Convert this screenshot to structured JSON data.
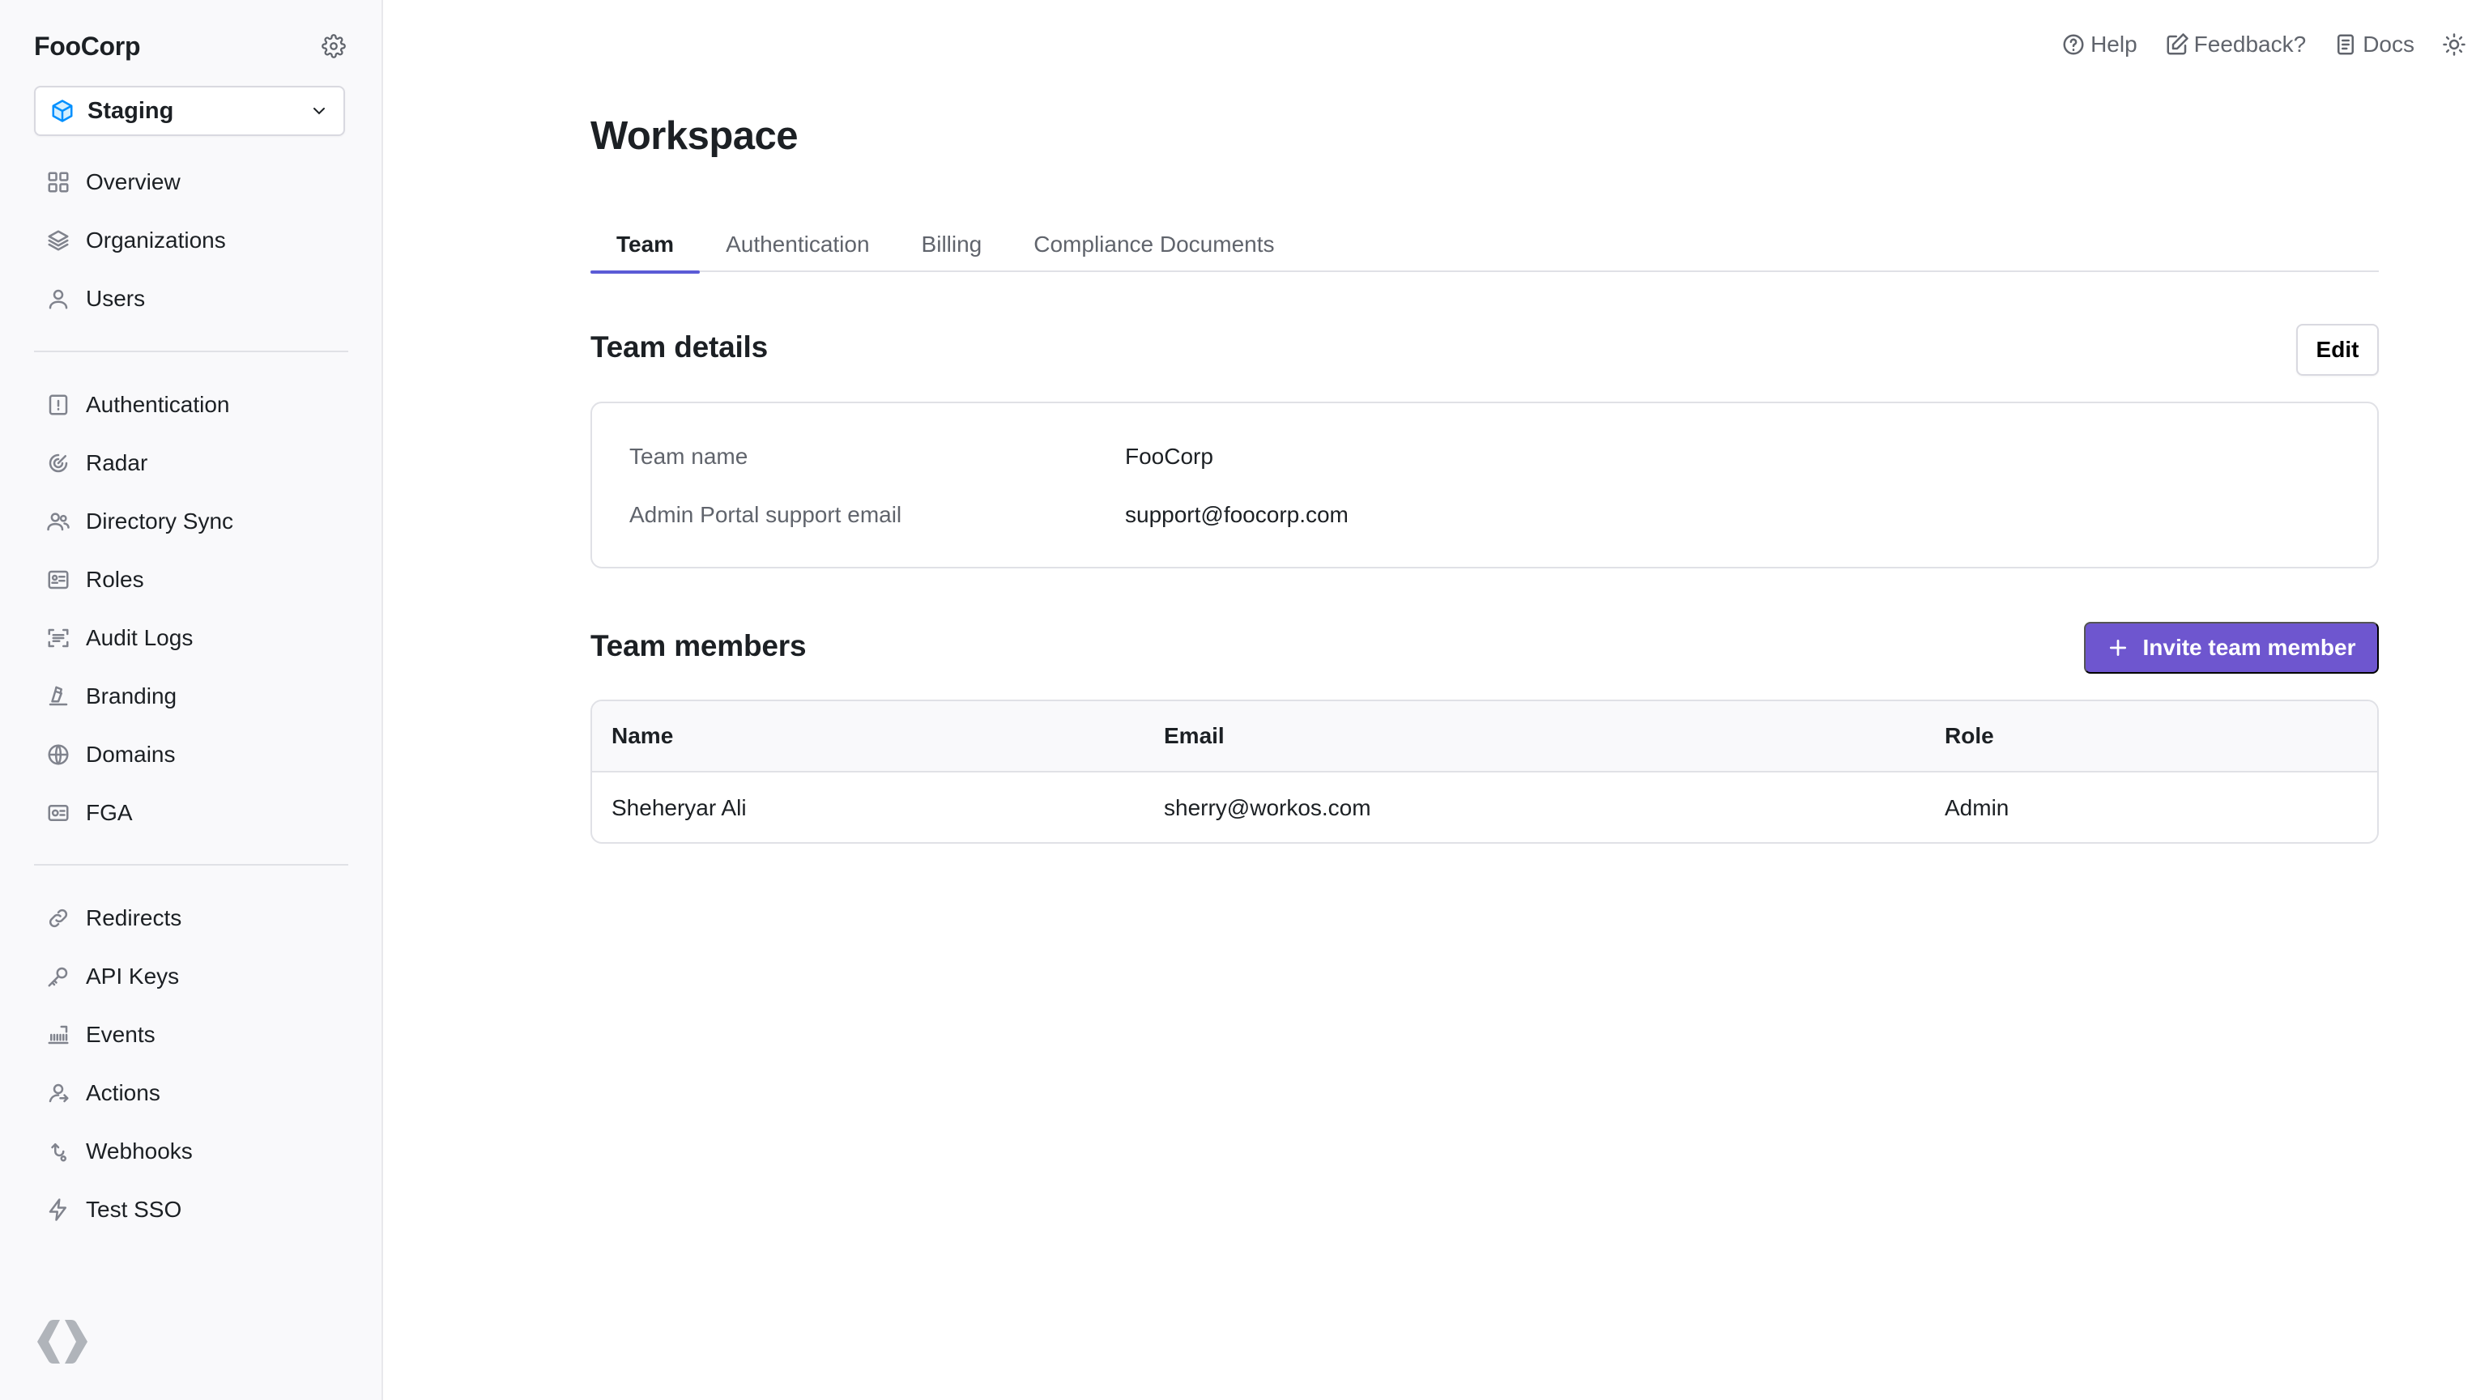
{
  "sidebar": {
    "brand": "FooCorp",
    "environment": "Staging",
    "primary_items": [
      {
        "label": "Overview",
        "icon": "grid-icon"
      },
      {
        "label": "Organizations",
        "icon": "layers-icon"
      },
      {
        "label": "Users",
        "icon": "user-icon"
      }
    ],
    "product_items": [
      {
        "label": "Authentication",
        "icon": "key-square-icon"
      },
      {
        "label": "Radar",
        "icon": "radar-icon"
      },
      {
        "label": "Directory Sync",
        "icon": "users-sync-icon"
      },
      {
        "label": "Roles",
        "icon": "id-card-icon"
      },
      {
        "label": "Audit Logs",
        "icon": "scan-icon"
      },
      {
        "label": "Branding",
        "icon": "brush-icon"
      },
      {
        "label": "Domains",
        "icon": "globe-icon"
      },
      {
        "label": "FGA",
        "icon": "ticket-icon"
      }
    ],
    "dev_items": [
      {
        "label": "Redirects",
        "icon": "link-icon"
      },
      {
        "label": "API Keys",
        "icon": "key-icon"
      },
      {
        "label": "Events",
        "icon": "events-icon"
      },
      {
        "label": "Actions",
        "icon": "actions-icon"
      },
      {
        "label": "Webhooks",
        "icon": "webhook-icon"
      },
      {
        "label": "Test SSO",
        "icon": "lightning-icon"
      }
    ]
  },
  "topbar": {
    "help": "Help",
    "feedback": "Feedback?",
    "docs": "Docs"
  },
  "page": {
    "title": "Workspace",
    "tabs": [
      "Team",
      "Authentication",
      "Billing",
      "Compliance Documents"
    ],
    "active_tab": "Team"
  },
  "team_details": {
    "title": "Team details",
    "edit_label": "Edit",
    "rows": [
      {
        "label": "Team name",
        "value": "FooCorp"
      },
      {
        "label": "Admin Portal support email",
        "value": "support@foocorp.com"
      }
    ]
  },
  "team_members": {
    "title": "Team members",
    "invite_label": "Invite team member",
    "columns": [
      "Name",
      "Email",
      "Role"
    ],
    "rows": [
      {
        "name": "Sheheryar Ali",
        "email": "sherry@workos.com",
        "role": "Admin"
      }
    ]
  },
  "colors": {
    "accent": "#6e56cf",
    "tab_indicator": "#5b5bd6",
    "sidebar_bg": "#f9f9fb"
  }
}
